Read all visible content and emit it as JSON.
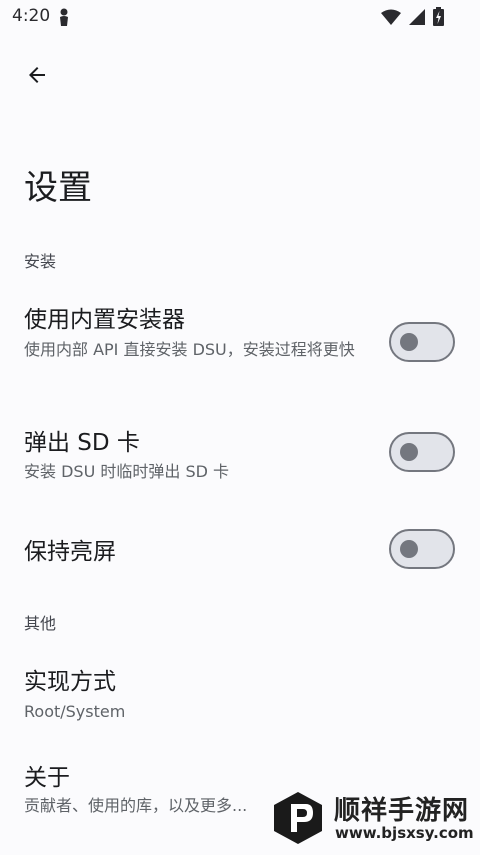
{
  "status_bar": {
    "time": "4:20",
    "icons": [
      "person-icon",
      "wifi-icon",
      "signal-icon",
      "battery-charging-icon"
    ]
  },
  "toolbar": {
    "back_icon": "arrow-back-icon"
  },
  "page": {
    "title": "设置"
  },
  "sections": {
    "install": {
      "header": "安装",
      "items": [
        {
          "title": "使用内置安装器",
          "summary": "使用内部 API 直接安装 DSU，安装过程将更快",
          "toggle_on": false
        },
        {
          "title": "弹出 SD 卡",
          "summary": "安装 DSU 时临时弹出 SD 卡",
          "toggle_on": false
        },
        {
          "title": "保持亮屏",
          "toggle_on": false
        }
      ]
    },
    "other": {
      "header": "其他",
      "items": [
        {
          "title": "实现方式",
          "summary": "Root/System"
        },
        {
          "title": "关于",
          "summary": "贡献者、使用的库，以及更多..."
        }
      ]
    }
  },
  "watermark": {
    "name": "顺祥手游网",
    "url": "www.bjsxsy.com"
  },
  "colors": {
    "background": "#fbfbfd",
    "toggle_track": "#e2e4ea",
    "toggle_outline": "#74777f"
  }
}
